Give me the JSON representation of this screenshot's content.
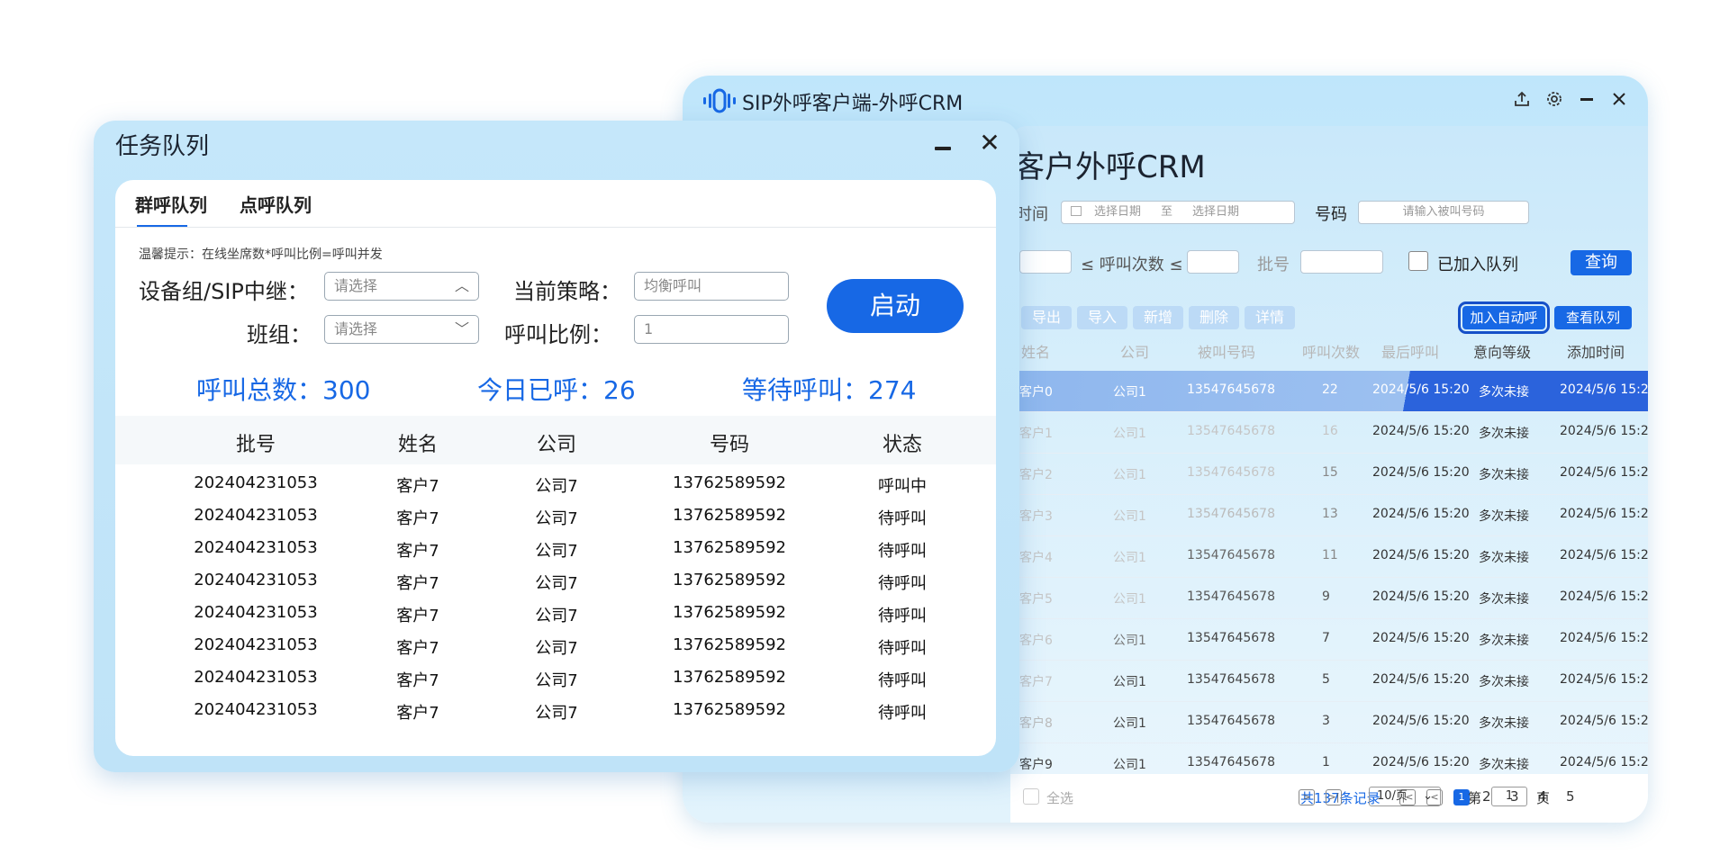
{
  "crm_window": {
    "app_title": "SIP外呼客户端-外呼CRM",
    "page_title": "客户外呼CRM",
    "filters": {
      "time_label": "时间",
      "date_from_placeholder": "选择日期",
      "date_sep": "至",
      "date_to_placeholder": "选择日期",
      "number_label": "号码",
      "number_placeholder": "请输入被叫号码",
      "call_count_label": "≤ 呼叫次数 ≤",
      "batch_label": "批号",
      "queued_label": "已加入队列",
      "query_button": "查询"
    },
    "actions": {
      "export": "导出",
      "import": "导入",
      "add": "新增",
      "delete": "删除",
      "detail": "详情",
      "add_auto_call": "加入自动呼",
      "view_queue": "查看队列"
    },
    "columns": [
      "姓名",
      "公司",
      "被叫号码",
      "呼叫次数",
      "最后呼叫",
      "意向等级",
      "添加时间"
    ],
    "rows": [
      {
        "name": "客户0",
        "company": "公司1",
        "phone": "13547645678",
        "count": "22",
        "last": "2024/5/6 15:20",
        "level": "多次未接",
        "added": "2024/5/6 15:20"
      },
      {
        "name": "客户1",
        "company": "公司1",
        "phone": "13547645678",
        "count": "16",
        "last": "2024/5/6 15:20",
        "level": "多次未接",
        "added": "2024/5/6 15:20"
      },
      {
        "name": "客户2",
        "company": "公司1",
        "phone": "13547645678",
        "count": "15",
        "last": "2024/5/6 15:20",
        "level": "多次未接",
        "added": "2024/5/6 15:20"
      },
      {
        "name": "客户3",
        "company": "公司1",
        "phone": "13547645678",
        "count": "13",
        "last": "2024/5/6 15:20",
        "level": "多次未接",
        "added": "2024/5/6 15:20"
      },
      {
        "name": "客户4",
        "company": "公司1",
        "phone": "13547645678",
        "count": "11",
        "last": "2024/5/6 15:20",
        "level": "多次未接",
        "added": "2024/5/6 15:20"
      },
      {
        "name": "客户5",
        "company": "公司1",
        "phone": "13547645678",
        "count": "9",
        "last": "2024/5/6 15:20",
        "level": "多次未接",
        "added": "2024/5/6 15:20"
      },
      {
        "name": "客户6",
        "company": "公司1",
        "phone": "13547645678",
        "count": "7",
        "last": "2024/5/6 15:20",
        "level": "多次未接",
        "added": "2024/5/6 15:20"
      },
      {
        "name": "客户7",
        "company": "公司1",
        "phone": "13547645678",
        "count": "5",
        "last": "2024/5/6 15:20",
        "level": "多次未接",
        "added": "2024/5/6 15:20"
      },
      {
        "name": "客户8",
        "company": "公司1",
        "phone": "13547645678",
        "count": "3",
        "last": "2024/5/6 15:20",
        "level": "多次未接",
        "added": "2024/5/6 15:20"
      },
      {
        "name": "客户9",
        "company": "公司1",
        "phone": "13547645678",
        "count": "1",
        "last": "2024/5/6 15:20",
        "level": "多次未接",
        "added": "2024/5/6 15:20"
      }
    ],
    "footer": {
      "select_all": "全选",
      "total": "共137条记录",
      "pages": [
        "1",
        "2",
        "3",
        "4",
        "5"
      ],
      "current_page": "1",
      "page_size": "10/页",
      "goto_prefix": "第",
      "goto_value": "1",
      "goto_suffix": "页"
    }
  },
  "task_window": {
    "title": "任务队列",
    "tabs": [
      "群呼队列",
      "点呼队列"
    ],
    "tip": "温馨提示：在线坐席数*呼叫比例=呼叫并发",
    "device_group_label": "设备组/SIP中继：",
    "device_group_placeholder": "请选择",
    "strategy_label": "当前策略：",
    "strategy_placeholder": "均衡呼叫",
    "team_label": "班组：",
    "team_placeholder": "请选择",
    "ratio_label": "呼叫比例：",
    "ratio_placeholder": "1",
    "start_button": "启动",
    "stats": {
      "total": "呼叫总数：300",
      "today": "今日已呼：26",
      "waiting": "等待呼叫：274"
    },
    "columns": [
      "批号",
      "姓名",
      "公司",
      "号码",
      "状态"
    ],
    "rows": [
      {
        "batch": "202404231053",
        "name": "客户7",
        "company": "公司7",
        "phone": "13762589592",
        "status": "呼叫中"
      },
      {
        "batch": "202404231053",
        "name": "客户7",
        "company": "公司7",
        "phone": "13762589592",
        "status": "待呼叫"
      },
      {
        "batch": "202404231053",
        "name": "客户7",
        "company": "公司7",
        "phone": "13762589592",
        "status": "待呼叫"
      },
      {
        "batch": "202404231053",
        "name": "客户7",
        "company": "公司7",
        "phone": "13762589592",
        "status": "待呼叫"
      },
      {
        "batch": "202404231053",
        "name": "客户7",
        "company": "公司7",
        "phone": "13762589592",
        "status": "待呼叫"
      },
      {
        "batch": "202404231053",
        "name": "客户7",
        "company": "公司7",
        "phone": "13762589592",
        "status": "待呼叫"
      },
      {
        "batch": "202404231053",
        "name": "客户7",
        "company": "公司7",
        "phone": "13762589592",
        "status": "待呼叫"
      },
      {
        "batch": "202404231053",
        "name": "客户7",
        "company": "公司7",
        "phone": "13762589592",
        "status": "待呼叫"
      }
    ]
  },
  "colors": {
    "accent": "#1768e5",
    "window_bg": "#c5e7fa",
    "selected_row": "#2b63dc"
  },
  "icons": {
    "app": "sound-wave-icon",
    "upload": "upload-icon",
    "settings": "gear-icon",
    "minimize": "minimize-icon",
    "close": "close-icon"
  }
}
